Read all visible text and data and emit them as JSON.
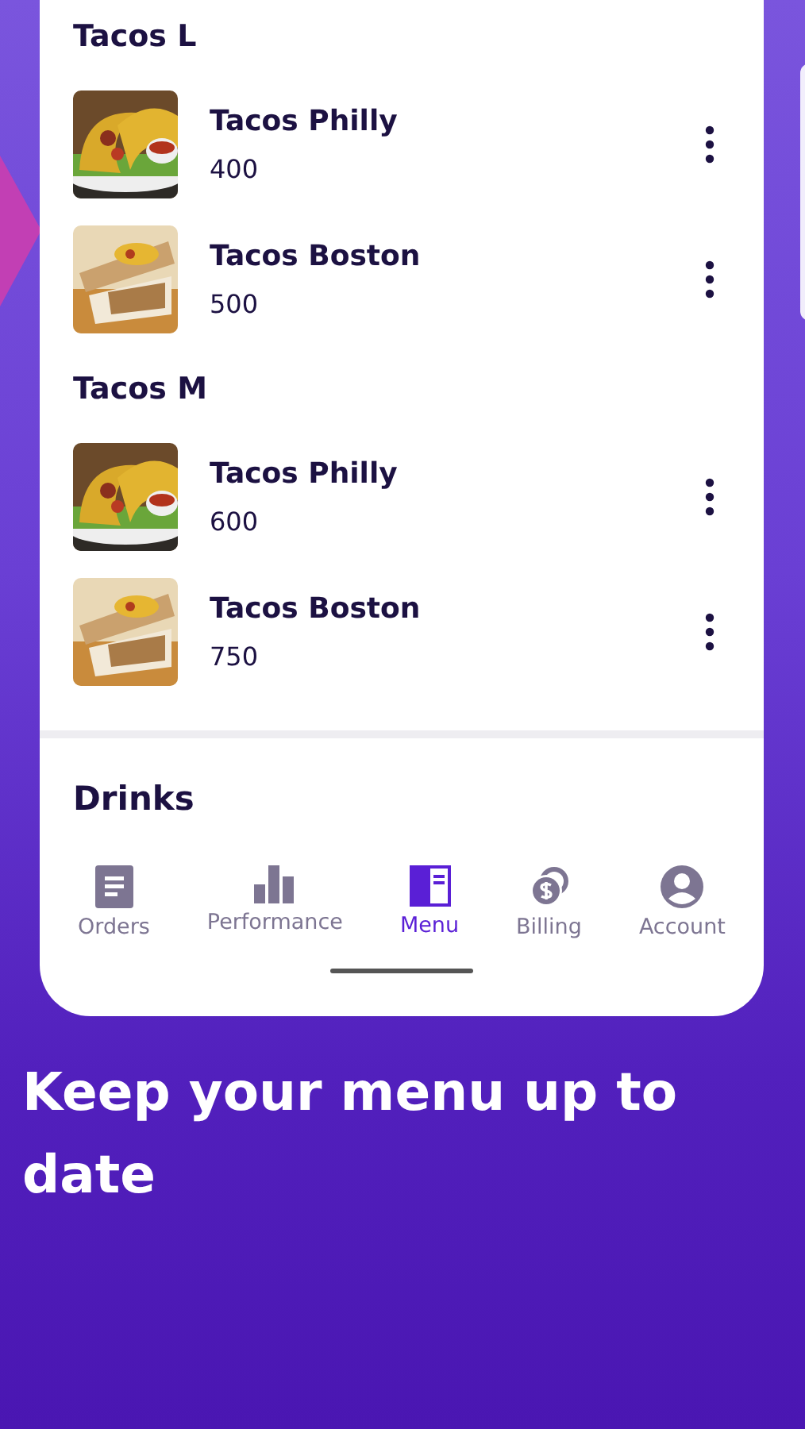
{
  "sections": [
    {
      "title": "Tacos L",
      "items": [
        {
          "name": "Tacos Philly",
          "price": "400"
        },
        {
          "name": "Tacos Boston",
          "price": "500"
        }
      ]
    },
    {
      "title": "Tacos M",
      "items": [
        {
          "name": "Tacos Philly",
          "price": "600"
        },
        {
          "name": "Tacos Boston",
          "price": "750"
        }
      ]
    }
  ],
  "next_section": "Drinks",
  "nav": [
    {
      "label": "Orders",
      "selected": false
    },
    {
      "label": "Performance",
      "selected": false
    },
    {
      "label": "Menu",
      "selected": true
    },
    {
      "label": "Billing",
      "selected": false
    },
    {
      "label": "Account",
      "selected": false
    }
  ],
  "headline": "Keep your menu up to date"
}
